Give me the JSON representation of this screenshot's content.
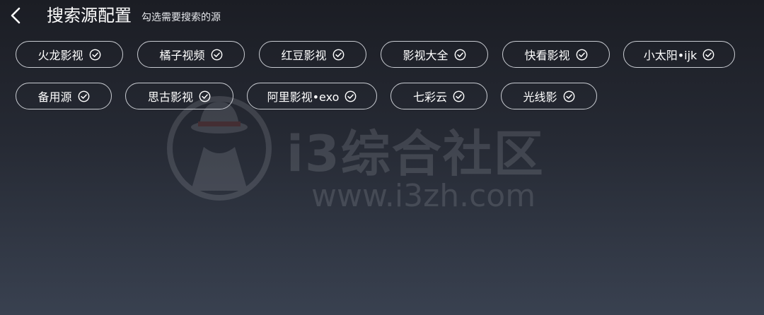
{
  "header": {
    "back_icon": "chevron-left-icon",
    "title": "搜索源配置",
    "subtitle": "勾选需要搜索的源"
  },
  "sources": [
    {
      "label": "火龙影视",
      "checked": true
    },
    {
      "label": "橘子视频",
      "checked": true
    },
    {
      "label": "红豆影视",
      "checked": true
    },
    {
      "label": "影视大全",
      "checked": true
    },
    {
      "label": "快看影视",
      "checked": true
    },
    {
      "label": "小太阳•ijk",
      "checked": true
    },
    {
      "label": "备用源",
      "checked": true
    },
    {
      "label": "思古影视",
      "checked": true
    },
    {
      "label": "阿里影视•exo",
      "checked": true
    },
    {
      "label": "七彩云",
      "checked": true
    },
    {
      "label": "光线影",
      "checked": true
    }
  ],
  "watermark": {
    "brand": "i3综合社区",
    "url": "www.i3zh.com"
  },
  "colors": {
    "chip_border": "#c9ccd2",
    "text": "#ffffff",
    "background_top": "#1b1d24",
    "background_bottom": "#394150"
  }
}
